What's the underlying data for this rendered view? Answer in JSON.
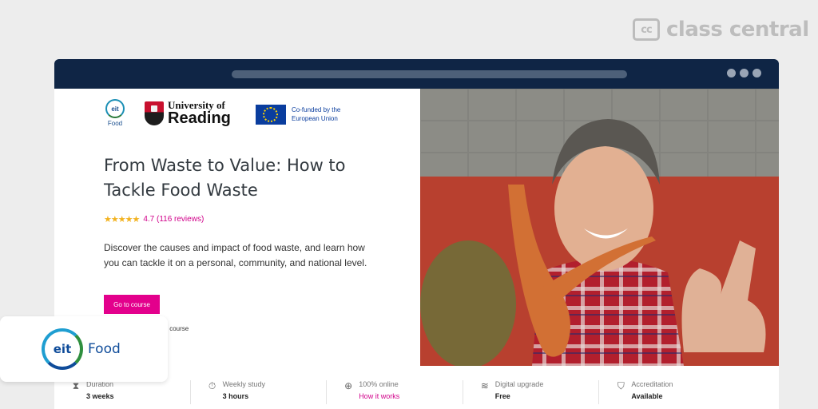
{
  "brand": {
    "name": "class central",
    "logo_text": "cc"
  },
  "partners": {
    "eit_small": {
      "mark": "eit",
      "word": "Food"
    },
    "reading": {
      "line1": "University of",
      "line2": "Reading"
    },
    "eu": {
      "line1": "Co-funded by the",
      "line2": "European Union"
    }
  },
  "course": {
    "title": "From Waste to Value: How to Tackle Food Waste",
    "stars": "★★★★★",
    "rating": "4.7 (116 reviews)",
    "description": "Discover the causes and impact of food waste, and learn how you can tackle it on a personal, community, and national level.",
    "cta_label": "Go to course",
    "partial_text": "s course"
  },
  "stats": [
    {
      "icon": "hourglass-icon",
      "glyph": "⧗",
      "label": "Duration",
      "value": "3 weeks",
      "link": false
    },
    {
      "icon": "stopwatch-icon",
      "glyph": "⏱",
      "label": "Weekly study",
      "value": "3 hours",
      "link": false
    },
    {
      "icon": "globe-icon",
      "glyph": "⊕",
      "label": "100% online",
      "value": "How it works",
      "link": true
    },
    {
      "icon": "upgrade-icon",
      "glyph": "≋",
      "label": "Digital upgrade",
      "value": "Free",
      "link": false
    },
    {
      "icon": "shield-check-icon",
      "glyph": "⛉",
      "label": "Accreditation",
      "value": "Available",
      "link": false
    }
  ],
  "eit_card": {
    "mark": "eit",
    "word": "Food"
  },
  "colors": {
    "navy": "#0f2545",
    "accent": "#e3008c",
    "star": "#f2b21f"
  }
}
